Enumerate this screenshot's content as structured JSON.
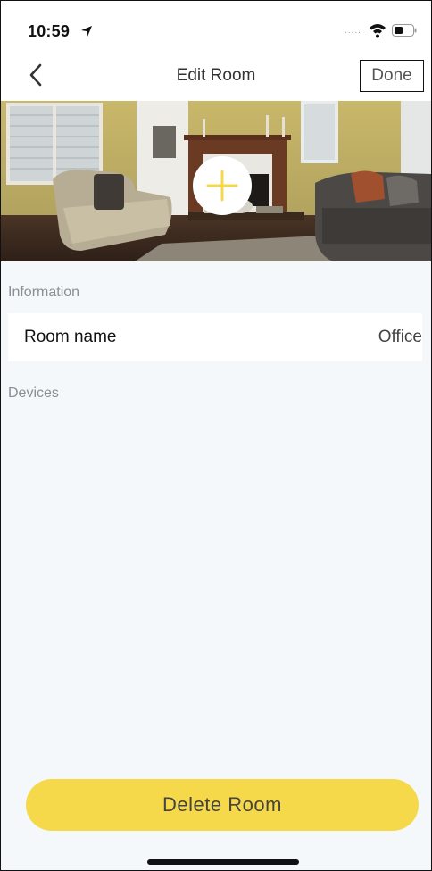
{
  "status_bar": {
    "time": "10:59",
    "signal_dots": "....."
  },
  "nav": {
    "title": "Edit Room",
    "done_label": "Done"
  },
  "photo": {
    "add_icon_color": "#f5d94b"
  },
  "information": {
    "section_label": "Information",
    "room_name_label": "Room name",
    "room_name_value": "Office"
  },
  "devices": {
    "section_label": "Devices"
  },
  "actions": {
    "delete_label": "Delete Room"
  },
  "colors": {
    "accent": "#f5d94b",
    "background": "#f4f8fb"
  }
}
